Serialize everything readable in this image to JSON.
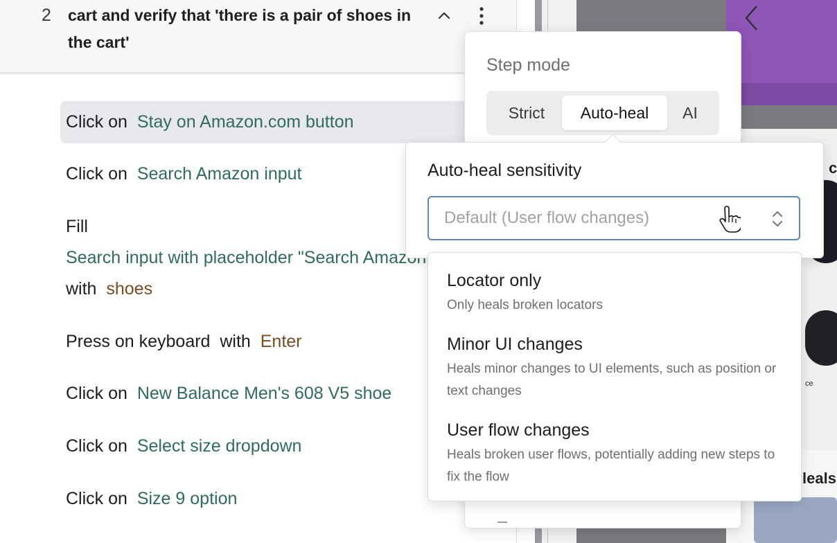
{
  "step": {
    "number": "2",
    "title": "cart and verify that 'there is a pair of shoes in the cart'"
  },
  "actions": [
    {
      "verb": "Click on",
      "target": "Stay on Amazon.com button"
    },
    {
      "verb": "Click on",
      "target": "Search Amazon input"
    },
    {
      "verb": "Fill",
      "target": "Search input with placeholder \"Search Amazon\"",
      "with_word": "with",
      "value": "shoes"
    },
    {
      "verb": "Press on keyboard",
      "with_word": "with",
      "value": "Enter"
    },
    {
      "verb": "Click on",
      "target": "New Balance Men's 608 V5 shoe"
    },
    {
      "verb": "Click on",
      "target": "Select size dropdown"
    },
    {
      "verb": "Click on",
      "target": "Size 9 option"
    }
  ],
  "step_mode": {
    "title": "Step mode",
    "options": [
      "Strict",
      "Auto-heal",
      "AI"
    ],
    "selected": "Auto-heal"
  },
  "sensitivity": {
    "title": "Auto-heal sensitivity",
    "placeholder": "Default (User flow changes)",
    "options": [
      {
        "label": "Locator only",
        "description": "Only heals broken locators"
      },
      {
        "label": "Minor UI changes",
        "description": "Heals minor changes to UI elements, such as position or text changes"
      },
      {
        "label": "User flow changes",
        "description": "Heals broken user flows, potentially adding new steps to fix the flow"
      }
    ]
  },
  "preview": {
    "side_text_1": "cc",
    "side_text_2": "leals",
    "tiny_text": "ce"
  },
  "colors": {
    "target_text": "#2f6b5f",
    "value_text": "#7a4b1e",
    "focus_border": "#5b87b8"
  }
}
